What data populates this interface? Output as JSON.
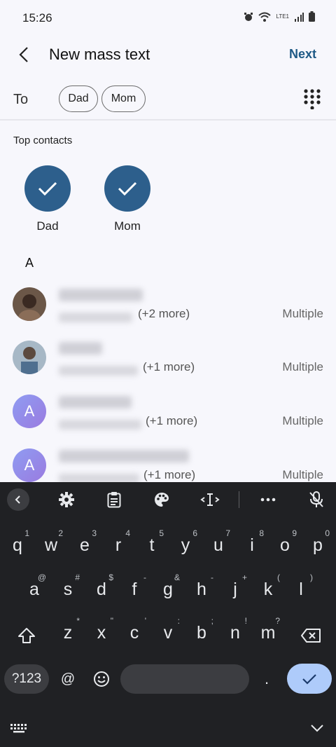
{
  "status": {
    "time": "15:26",
    "network": "LTE1"
  },
  "header": {
    "title": "New mass text",
    "next_label": "Next"
  },
  "recipients": {
    "to_label": "To",
    "chips": [
      "Dad",
      "Mom"
    ]
  },
  "top_contacts": {
    "label": "Top contacts",
    "items": [
      "Dad",
      "Mom"
    ]
  },
  "contacts": {
    "section_letter": "A",
    "rows": [
      {
        "more": "(+2 more)",
        "type": "Multiple",
        "avatar": "photo"
      },
      {
        "more": "(+1 more)",
        "type": "Multiple",
        "avatar": "photo"
      },
      {
        "more": "(+1 more)",
        "type": "Multiple",
        "avatar": "A"
      },
      {
        "more": "(+1 more)",
        "type": "Multiple",
        "avatar": "A"
      }
    ]
  },
  "keyboard": {
    "row1": [
      [
        "q",
        "1"
      ],
      [
        "w",
        "2"
      ],
      [
        "e",
        "3"
      ],
      [
        "r",
        "4"
      ],
      [
        "t",
        "5"
      ],
      [
        "y",
        "6"
      ],
      [
        "u",
        "7"
      ],
      [
        "i",
        "8"
      ],
      [
        "o",
        "9"
      ],
      [
        "p",
        "0"
      ]
    ],
    "row2": [
      [
        "a",
        "@"
      ],
      [
        "s",
        "#"
      ],
      [
        "d",
        "$"
      ],
      [
        "f",
        "-"
      ],
      [
        "g",
        "&"
      ],
      [
        "h",
        "-"
      ],
      [
        "j",
        "+"
      ],
      [
        "k",
        "("
      ],
      [
        "l",
        ")"
      ]
    ],
    "row3": [
      [
        "z",
        "*"
      ],
      [
        "x",
        "\""
      ],
      [
        "c",
        "'"
      ],
      [
        "v",
        ":"
      ],
      [
        "b",
        ";"
      ],
      [
        "n",
        "!"
      ],
      [
        "m",
        "?"
      ]
    ],
    "symbols_label": "?123",
    "at_label": "@",
    "period_label": ".",
    "accent_color": "#aecbfa"
  },
  "colors": {
    "accent": "#2d5f8c",
    "next": "#1f5a86",
    "keyboard_bg": "#202124"
  }
}
